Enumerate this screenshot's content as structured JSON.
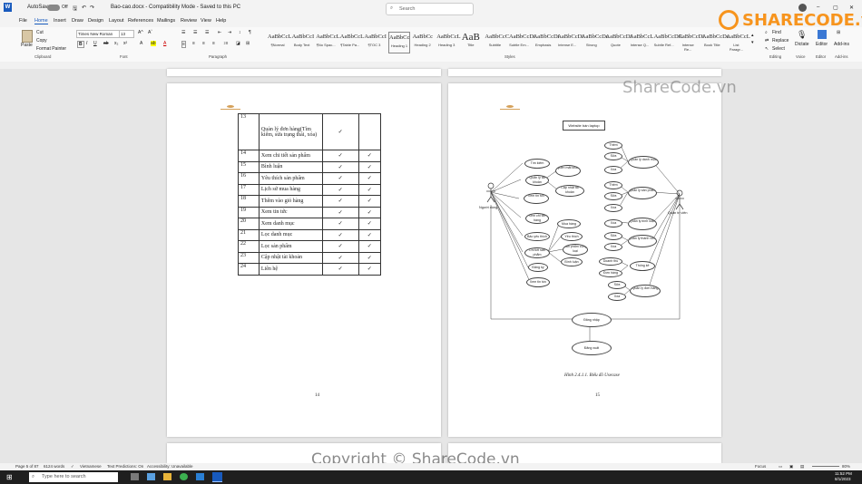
{
  "titlebar": {
    "autosave": "AutoSave",
    "toggle": "Off",
    "doc_title": "Bao-cao.docx - Compatibility Mode - Saved to this PC",
    "search_placeholder": "Search"
  },
  "menu": [
    "File",
    "Home",
    "Insert",
    "Draw",
    "Design",
    "Layout",
    "References",
    "Mailings",
    "Review",
    "View",
    "Help"
  ],
  "ribbon": {
    "clipboard": {
      "paste": "Paste",
      "cut": "Cut",
      "copy": "Copy",
      "format_painter": "Format Painter",
      "label": "Clipboard"
    },
    "font": {
      "name": "Times New Roman",
      "size": "13",
      "label": "Font"
    },
    "paragraph_label": "Paragraph",
    "styles": [
      {
        "sample": "AaBbCcL",
        "name": "¶Normal"
      },
      {
        "sample": "AaBbCcI",
        "name": "Body Text"
      },
      {
        "sample": "AaBbCcL",
        "name": "¶No Spac..."
      },
      {
        "sample": "AaBbCcL",
        "name": "¶Table Pa..."
      },
      {
        "sample": "AaBbCcI",
        "name": "¶TOC 3"
      },
      {
        "sample": "AaBbCc",
        "name": "Heading 1"
      },
      {
        "sample": "AaBbCc",
        "name": "Heading 2"
      },
      {
        "sample": "AaBbCcL",
        "name": "Heading 3"
      },
      {
        "sample": "AaB",
        "name": "Title"
      },
      {
        "sample": "AaBbCcC",
        "name": "Subtitle"
      },
      {
        "sample": "AaBbCcDi",
        "name": "Subtle Em..."
      },
      {
        "sample": "AaBbCcDi",
        "name": "Emphasis"
      },
      {
        "sample": "AaBbCcDi",
        "name": "Intense E..."
      },
      {
        "sample": "AaBbCcDc",
        "name": "Strong"
      },
      {
        "sample": "AaBbCcDi",
        "name": "Quote"
      },
      {
        "sample": "AaBbCcL",
        "name": "Intense Q..."
      },
      {
        "sample": "AaBbCcDC",
        "name": "Subtle Ref..."
      },
      {
        "sample": "AaBbCcDi",
        "name": "Intense Re..."
      },
      {
        "sample": "AaBbCcDc",
        "name": "Book Title"
      },
      {
        "sample": "AaBbCcL",
        "name": "List Paragr..."
      }
    ],
    "styles_label": "Styles",
    "editing": {
      "find": "Find",
      "replace": "Replace",
      "select": "Select",
      "label": "Editing"
    },
    "voice": {
      "dictate": "Dictate",
      "label": "Voice"
    },
    "editor": {
      "label": "Editor",
      "group": "Editor"
    },
    "addins": {
      "label": "Add-ins",
      "group": "Add-ins"
    }
  },
  "page14": {
    "rows": [
      {
        "n": "13",
        "name": "Quản lý đơn hàng(Tìm kiếm, sửa trạng thái, xóa)",
        "c1": "✓",
        "c2": ""
      },
      {
        "n": "14",
        "name": "Xem chi tiết sản phẩm",
        "c1": "✓",
        "c2": "✓"
      },
      {
        "n": "15",
        "name": "Bình luận",
        "c1": "✓",
        "c2": "✓"
      },
      {
        "n": "16",
        "name": "Yêu thích sản phẩm",
        "c1": "✓",
        "c2": "✓"
      },
      {
        "n": "17",
        "name": "Lịch sử mua hàng",
        "c1": "✓",
        "c2": "✓"
      },
      {
        "n": "18",
        "name": "Thêm vào giỏ hàng",
        "c1": "✓",
        "c2": "✓"
      },
      {
        "n": "19",
        "name": "Xem tin tức",
        "c1": "✓",
        "c2": "✓"
      },
      {
        "n": "20",
        "name": "Xem danh mục",
        "c1": "✓",
        "c2": "✓"
      },
      {
        "n": "21",
        "name": "Lọc danh mục",
        "c1": "✓",
        "c2": "✓"
      },
      {
        "n": "22",
        "name": "Lọc sản phẩm",
        "c1": "✓",
        "c2": "✓"
      },
      {
        "n": "23",
        "name": "Cập nhật tài khoản",
        "c1": "✓",
        "c2": "✓"
      },
      {
        "n": "24",
        "name": "Liên hệ",
        "c1": "✓",
        "c2": "✓"
      }
    ],
    "page_number": "14"
  },
  "page15": {
    "system_box": "Website bán laptop",
    "actor_user": "Người dùng",
    "actor_admin": "Quản trị viên",
    "left_cases": [
      "Tìm kiếm",
      "Quản lý tài khoản",
      "Xem tin tức",
      "Xem chi tiết hàng",
      "Bảo yêu thích",
      "Chi tiết sản phẩm",
      "Đăng ký",
      "Xem tin tức"
    ],
    "left_sub": [
      "Quên mật khẩu",
      "Cập nhật tài khoản",
      "Mua hàng",
      "Yêu thích",
      "Sản phẩm cùng loại",
      "Bình luận"
    ],
    "right_cases": [
      "Quản lý danh mục",
      "Quản lý sản phẩm",
      "Quản lý bình luận",
      "Quản lý thành viên",
      "Thống kê",
      "Quản lý đơn hàng"
    ],
    "right_sub": [
      "Thêm",
      "Sửa",
      "Xóa",
      "Thêm",
      "Sửa",
      "Xóa",
      "Xóa",
      "Sửa",
      "Xóa",
      "Doanh thu",
      "Đơn hàng",
      "Sửa",
      "Xóa"
    ],
    "login": "Đăng nhập",
    "logout": "Đăng xuất",
    "caption": "Hình 2.4.1.1. Biểu đồ Usecase",
    "page_number": "15"
  },
  "status": {
    "page": "Page 5 of 87",
    "words": "6124 words",
    "lang": "Vietnamese",
    "predictions": "Text Predictions: On",
    "accessibility": "Accessibility: Unavailable",
    "focus": "Focus",
    "zoom": "80%"
  },
  "taskbar": {
    "search_placeholder": "Type here to search",
    "time": "11:52 PM",
    "date": "8/1/2023"
  },
  "watermark": {
    "logo": "SHARECODE.vn",
    "mid": "ShareCode.vn",
    "footer": "Copyright © ShareCode.vn"
  },
  "colors": {
    "word_blue": "#185abd",
    "logo_orange": "#f7941d",
    "taskbar": "#1f1f1f"
  }
}
